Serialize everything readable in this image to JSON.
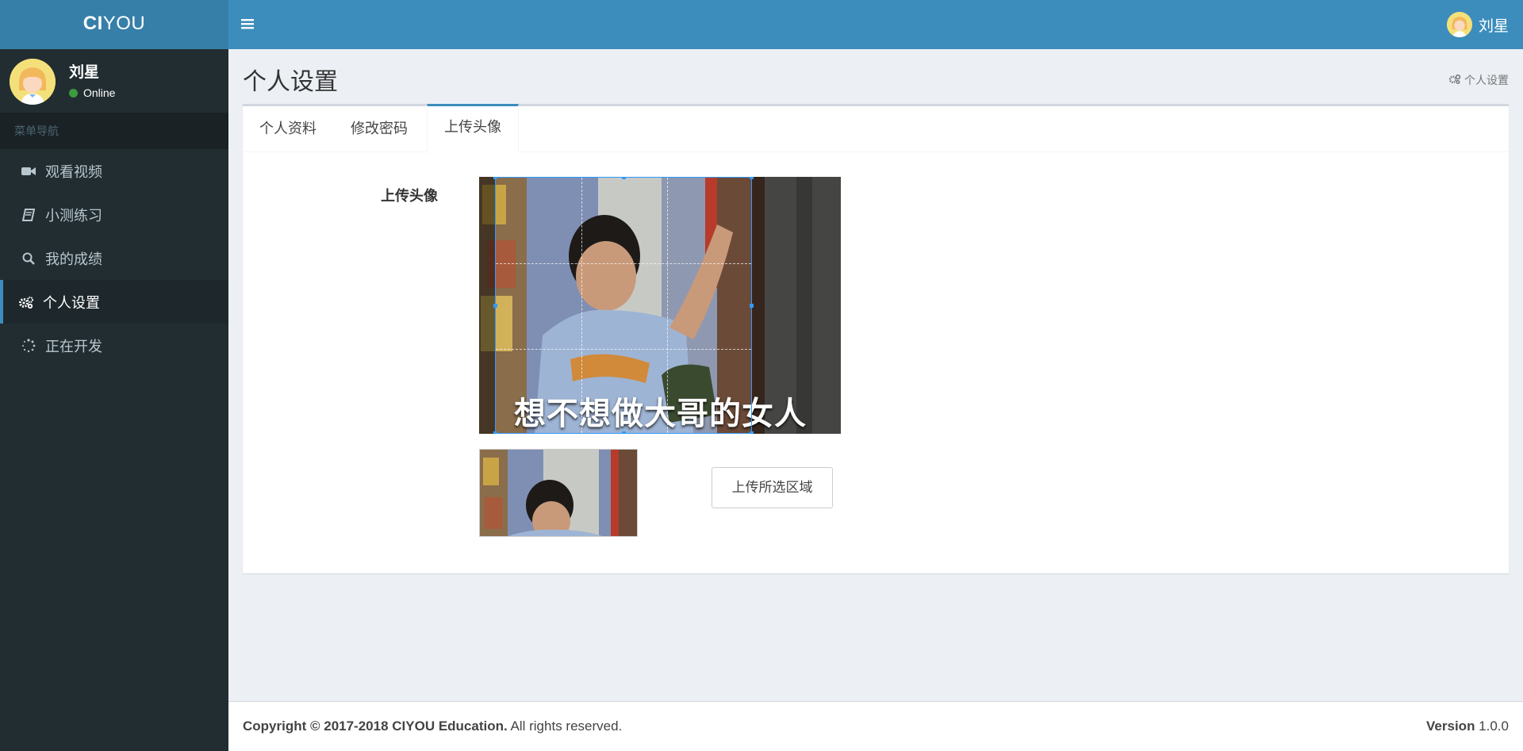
{
  "app": {
    "logo_bold": "CI",
    "logo_rest": "YOU"
  },
  "topbar": {
    "user_name": "刘星"
  },
  "sidebar": {
    "user_name": "刘星",
    "status": "Online",
    "menu_header": "菜单导航",
    "items": [
      {
        "label": "观看视频",
        "icon": "video-camera-icon"
      },
      {
        "label": "小测练习",
        "icon": "book-icon"
      },
      {
        "label": "我的成绩",
        "icon": "search-icon"
      },
      {
        "label": "个人设置",
        "icon": "gears-icon",
        "active": true
      },
      {
        "label": "正在开发",
        "icon": "spinner-icon"
      }
    ]
  },
  "page": {
    "title": "个人设置",
    "breadcrumb": "个人设置"
  },
  "tabs": [
    {
      "label": "个人资料"
    },
    {
      "label": "修改密码"
    },
    {
      "label": "上传头像",
      "active": true
    }
  ],
  "upload": {
    "field_label": "上传头像",
    "image_caption": "想不想做大哥的女人",
    "button_label": "上传所选区域"
  },
  "footer": {
    "copyright_bold": "Copyright © 2017-2018 CIYOU Education.",
    "copyright_rest": " All rights reserved.",
    "version_label": "Version",
    "version_value": " 1.0.0"
  },
  "colors": {
    "header": "#3c8dbc",
    "logo_bg": "#367fa9",
    "sidebar": "#222d32",
    "content_bg": "#ecf0f5"
  }
}
